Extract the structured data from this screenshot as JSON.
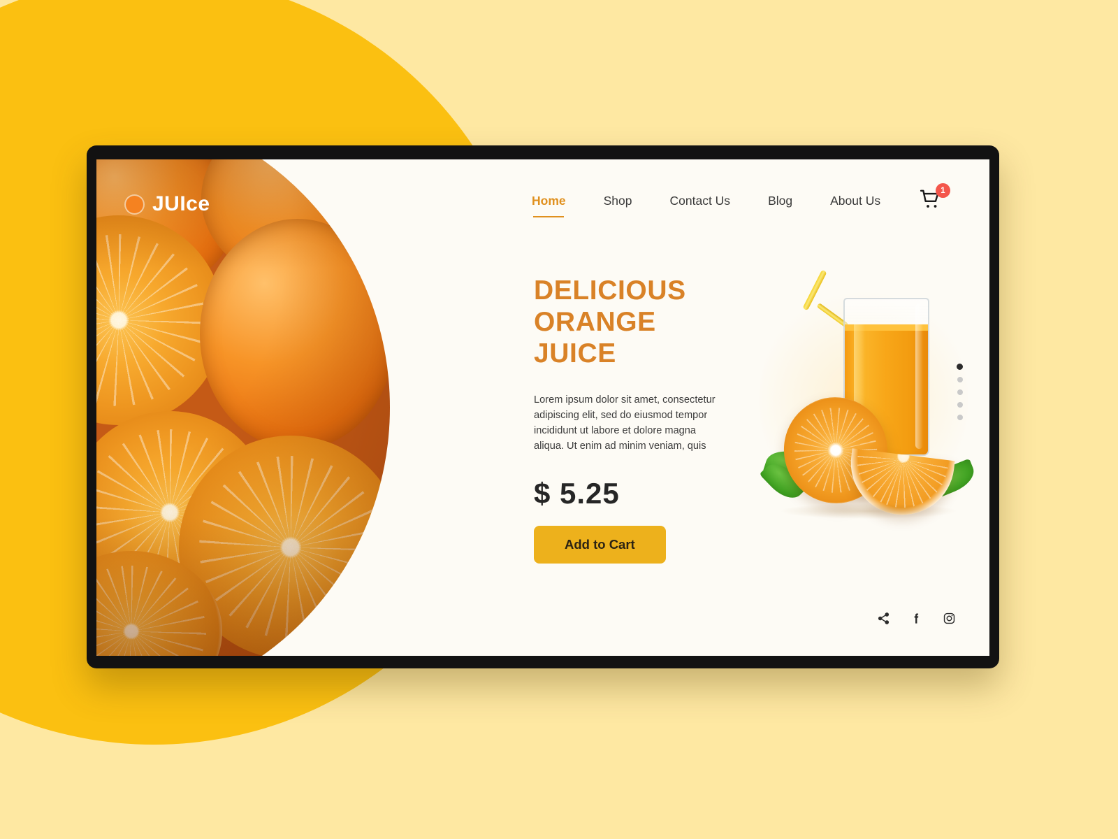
{
  "theme": {
    "page_background": "#FEE8A2",
    "accent_circle": "#FBC011",
    "headline_color": "#D98227",
    "cta_background": "#EDB11C",
    "badge_color": "#F4564B",
    "nav_active_color": "#E0901E"
  },
  "brand": {
    "logo_mark": "orange-dot-icon",
    "name": "JUIce"
  },
  "nav": {
    "items": [
      {
        "label": "Home",
        "active": true
      },
      {
        "label": "Shop",
        "active": false
      },
      {
        "label": "Contact Us",
        "active": false
      },
      {
        "label": "Blog",
        "active": false
      },
      {
        "label": "About Us",
        "active": false
      }
    ],
    "cart": {
      "icon": "shopping-cart-icon",
      "count": "1"
    }
  },
  "hero": {
    "headline_line1": "DELICIOUS",
    "headline_line2": "ORANGE",
    "headline_line3": "JUICE",
    "body": "Lorem ipsum dolor sit amet, consectetur adipiscing elit, sed do eiusmod tempor incididunt ut labore et dolore magna aliqua. Ut enim ad minim veniam, quis",
    "price": "$ 5.25",
    "cta_label": "Add to Cart",
    "product_image_alt": "glass-of-orange-juice-with-straw"
  },
  "slider": {
    "dots": [
      {
        "active": true
      },
      {
        "active": false
      },
      {
        "active": false
      },
      {
        "active": false
      },
      {
        "active": false
      }
    ]
  },
  "socials": [
    {
      "icon": "share-icon"
    },
    {
      "icon": "facebook-icon"
    },
    {
      "icon": "instagram-icon"
    }
  ]
}
